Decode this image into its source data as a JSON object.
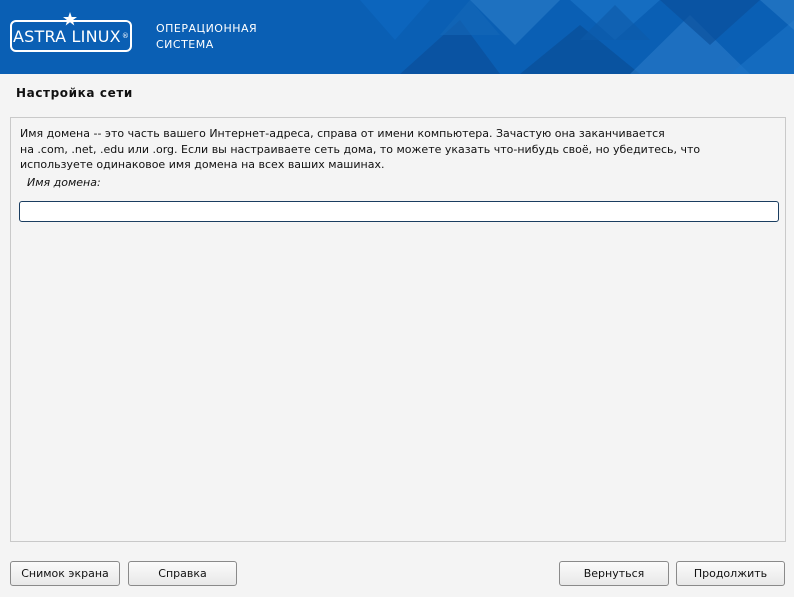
{
  "header": {
    "logo_text": "ASTRA LINUX",
    "logo_reg": "®",
    "subtitle_line1": "ОПЕРАЦИОННАЯ",
    "subtitle_line2": "СИСТЕМА",
    "colors": {
      "banner": "#0a5fb4",
      "banner_dark": "#0a4f9a",
      "banner_light": "#2f7fcb"
    }
  },
  "page": {
    "title": "Настройка сети"
  },
  "content": {
    "description_lines": [
      "Имя домена -- это часть вашего Интернет-адреса, справа от имени компьютера. Зачастую она заканчивается",
      "на .com, .net, .edu или .org. Если вы настраиваете сеть дома, то можете указать что-нибудь своё, но убедитесь, что",
      "используете одинаковое имя домена на всех ваших машинах."
    ],
    "field_label": "Имя домена:",
    "domain_value": "",
    "input_border_color": "#1a3d60"
  },
  "buttons": {
    "screenshot": "Снимок экрана",
    "help": "Справка",
    "back": "Вернуться",
    "continue": "Продолжить"
  }
}
